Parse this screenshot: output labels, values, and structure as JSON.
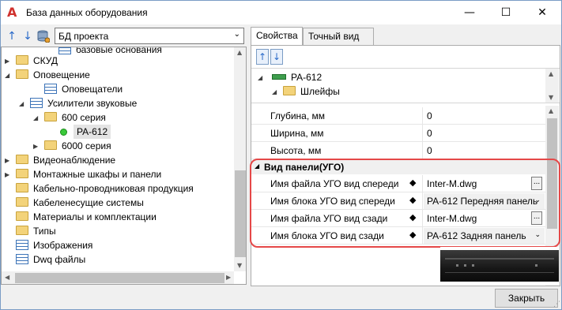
{
  "window": {
    "title": "База данных оборудования",
    "icon": "autocad-a-icon",
    "controls": {
      "minimize": "—",
      "maximize": "☐",
      "close": "✕"
    }
  },
  "left": {
    "toolbar": {
      "up": "↑",
      "down": "↓",
      "db": "db-icon"
    },
    "source": {
      "value": "БД проекта"
    },
    "tree": [
      {
        "label": "базовые основания",
        "icon": "table",
        "toggle": ""
      },
      {
        "label": "СКУД",
        "icon": "folder",
        "toggle": "▶"
      },
      {
        "label": "Оповещение",
        "icon": "folder",
        "toggle": "◢"
      },
      {
        "label": "Оповещатели",
        "icon": "table",
        "toggle": ""
      },
      {
        "label": "Усилители звуковые",
        "icon": "table",
        "toggle": "◢"
      },
      {
        "label": "600 серия",
        "icon": "folder",
        "toggle": "◢"
      },
      {
        "label": "PA-612",
        "icon": "dot",
        "toggle": ""
      },
      {
        "label": "6000 серия",
        "icon": "folder",
        "toggle": "▶"
      },
      {
        "label": "Видеонаблюдение",
        "icon": "folder",
        "toggle": "▶"
      },
      {
        "label": "Монтажные шкафы и панели",
        "icon": "folder",
        "toggle": "▶"
      },
      {
        "label": "Кабельно-проводниковая продукция",
        "icon": "folder",
        "toggle": ""
      },
      {
        "label": "Кабеленесущие системы",
        "icon": "folder",
        "toggle": ""
      },
      {
        "label": "Материалы и комплектации",
        "icon": "folder",
        "toggle": ""
      },
      {
        "label": "Типы",
        "icon": "folder",
        "toggle": ""
      },
      {
        "label": "Изображения",
        "icon": "table",
        "toggle": ""
      },
      {
        "label": "Dwq файлы",
        "icon": "table",
        "toggle": ""
      }
    ]
  },
  "right": {
    "tabs": [
      {
        "label": "Свойства",
        "active": true
      },
      {
        "label": "Точный вид",
        "active": false
      }
    ],
    "sort": {
      "up": "↑",
      "down": "↓"
    },
    "mini_tree": [
      {
        "label": "PA-612",
        "toggle": "◢"
      },
      {
        "label": "Шлейфы",
        "toggle": "◢"
      }
    ],
    "properties": [
      {
        "name": "Глубина, мм",
        "value": "0"
      },
      {
        "name": "Ширина, мм",
        "value": "0"
      },
      {
        "name": "Высота, мм",
        "value": "0"
      }
    ],
    "category": {
      "label": "Вид панели(УГО)",
      "toggle": "◢"
    },
    "ugo_props": [
      {
        "name": "Имя файла УГО вид спереди",
        "value": "Inter-M.dwg",
        "editor": "ellipsis"
      },
      {
        "name": "Имя блока УГО вид спереди",
        "value": "PA-612 Передняя панель",
        "editor": "dropdown"
      },
      {
        "name": "Имя файла УГО вид сзади",
        "value": "Inter-M.dwg",
        "editor": "ellipsis"
      },
      {
        "name": "Имя блока УГО вид сзади",
        "value": "PA-612 Задняя панель",
        "editor": "dropdown"
      }
    ],
    "diamond": "◆",
    "ellipsis": "...",
    "dropdown_arrow": "⌄"
  },
  "footer": {
    "close_label": "Закрыть"
  },
  "colors": {
    "highlight": "#e54848",
    "accent": "#2a6ac9",
    "folder": "#f3d37a"
  }
}
